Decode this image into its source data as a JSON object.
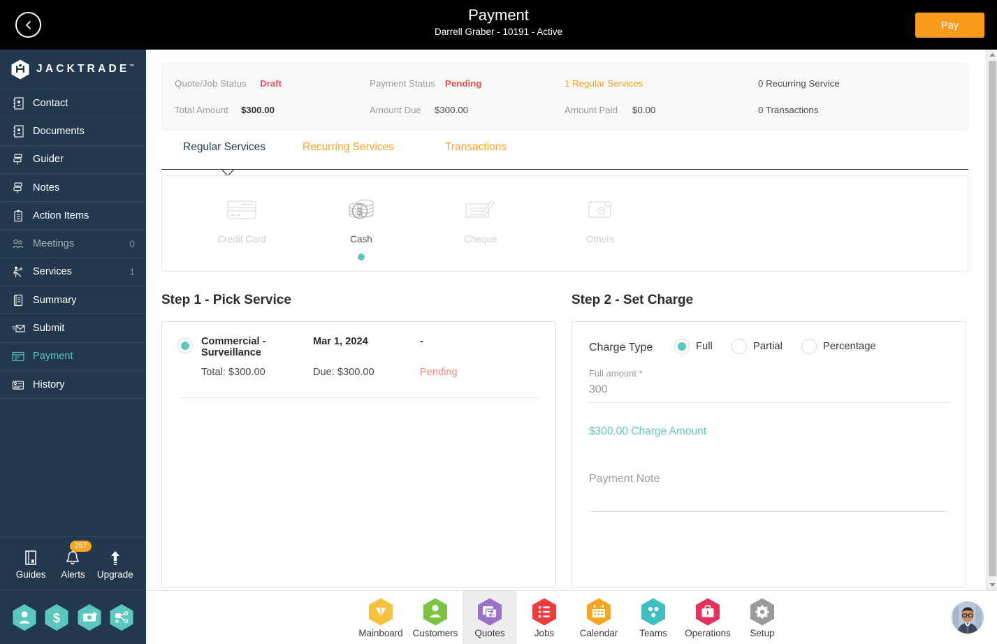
{
  "header": {
    "back_icon": "chevron-left-circle-icon",
    "title": "Payment",
    "subtitle": "Darrell Graber - 10191 - Active",
    "pay_label": "Pay",
    "pay_color": "#F89A1C",
    "background": "#000000"
  },
  "sidebar": {
    "brand": "JACKTRADE",
    "brand_tm": "™",
    "background": "#22384C",
    "active_color": "#5BC8BE",
    "items": [
      {
        "label": "Contact",
        "icon": "contact-book-icon",
        "count": "",
        "state": "normal"
      },
      {
        "label": "Documents",
        "icon": "document-icon",
        "count": "",
        "state": "normal"
      },
      {
        "label": "Guider",
        "icon": "signpost-icon",
        "count": "",
        "state": "normal"
      },
      {
        "label": "Notes",
        "icon": "signpost-icon",
        "count": "",
        "state": "normal"
      },
      {
        "label": "Action Items",
        "icon": "clipboard-icon",
        "count": "",
        "state": "normal"
      },
      {
        "label": "Meetings",
        "icon": "meeting-icon",
        "count": "0",
        "state": "dim"
      },
      {
        "label": "Services",
        "icon": "services-icon",
        "count": "1",
        "state": "normal"
      },
      {
        "label": "Summary",
        "icon": "summary-icon",
        "count": "",
        "state": "normal"
      },
      {
        "label": "Submit",
        "icon": "envelope-icon",
        "count": "",
        "state": "normal"
      },
      {
        "label": "Payment",
        "icon": "payment-card-icon",
        "count": "",
        "state": "active"
      },
      {
        "label": "History",
        "icon": "history-icon",
        "count": "",
        "state": "normal"
      }
    ],
    "footer": [
      {
        "label": "Guides",
        "icon": "book-icon",
        "badge": ""
      },
      {
        "label": "Alerts",
        "icon": "bell-icon",
        "badge": "267"
      },
      {
        "label": "Upgrade",
        "icon": "up-arrow-icon",
        "badge": ""
      }
    ],
    "quick_actions": [
      {
        "icon": "person-hex-icon"
      },
      {
        "icon": "dollar-hex-icon"
      },
      {
        "icon": "money-hex-icon"
      },
      {
        "icon": "workflow-hex-icon"
      }
    ]
  },
  "summary": {
    "quote_status_label": "Quote/Job Status",
    "quote_status_value": "Draft",
    "total_amount_label": "Total Amount",
    "total_amount_value": "$300.00",
    "payment_status_label": "Payment Status",
    "payment_status_value": "Pending",
    "amount_due_label": "Amount Due",
    "amount_due_value": "$300.00",
    "regular_services": "1 Regular Services",
    "amount_paid_label": "Amount Paid",
    "amount_paid_value": "$0.00",
    "recurring_service": "0 Recurring Service",
    "transactions": "0 Transactions"
  },
  "tabs": [
    {
      "label": "Regular Services",
      "active": true
    },
    {
      "label": "Recurring Services",
      "active": false
    },
    {
      "label": "Transactions",
      "active": false
    }
  ],
  "payment_methods": [
    {
      "label": "Credit Card",
      "icon": "credit-card-icon",
      "selected": false
    },
    {
      "label": "Cash",
      "icon": "cash-coins-icon",
      "selected": true
    },
    {
      "label": "Cheque",
      "icon": "cheque-icon",
      "selected": false
    },
    {
      "label": "Others",
      "icon": "wallet-icon",
      "selected": false
    }
  ],
  "step1": {
    "title": "Step 1 - Pick Service",
    "service": {
      "name": "Commercial - Surveillance",
      "date": "Mar 1, 2024",
      "third": "-",
      "total": "Total: $300.00",
      "due": "Due: $300.00",
      "status": "Pending",
      "selected": true
    }
  },
  "step2": {
    "title": "Step 2 - Set Charge",
    "charge_type_label": "Charge Type",
    "charge_types": [
      {
        "label": "Full",
        "selected": true
      },
      {
        "label": "Partial",
        "selected": false
      },
      {
        "label": "Percentage",
        "selected": false
      }
    ],
    "full_amount_label": "Full amount *",
    "full_amount_value": "300",
    "charge_amount_text": "$300.00 Charge Amount",
    "payment_note_label": "Payment Note",
    "payment_note_value": "",
    "info_icon": "info-icon"
  },
  "bottom_nav": [
    {
      "label": "Mainboard",
      "icon": "mainboard-icon",
      "color": "#F6C13F",
      "active": false
    },
    {
      "label": "Customers",
      "icon": "customers-icon",
      "color": "#7DC242",
      "active": false
    },
    {
      "label": "Quotes",
      "icon": "quotes-icon",
      "color": "#9B72C7",
      "active": true
    },
    {
      "label": "Jobs",
      "icon": "jobs-icon",
      "color": "#EE3B3B",
      "active": false
    },
    {
      "label": "Calendar",
      "icon": "calendar-icon",
      "color": "#F5A623",
      "active": false
    },
    {
      "label": "Teams",
      "icon": "teams-icon",
      "color": "#3FBFBF",
      "active": false
    },
    {
      "label": "Operations",
      "icon": "operations-icon",
      "color": "#E6325A",
      "active": false
    },
    {
      "label": "Setup",
      "icon": "setup-gear-icon",
      "color": "#9B9B9B",
      "active": false
    }
  ],
  "avatar": {
    "icon": "user-avatar"
  },
  "scrollbar": {
    "up_icon": "scroll-up-arrow",
    "down_icon": "scroll-down-arrow"
  }
}
